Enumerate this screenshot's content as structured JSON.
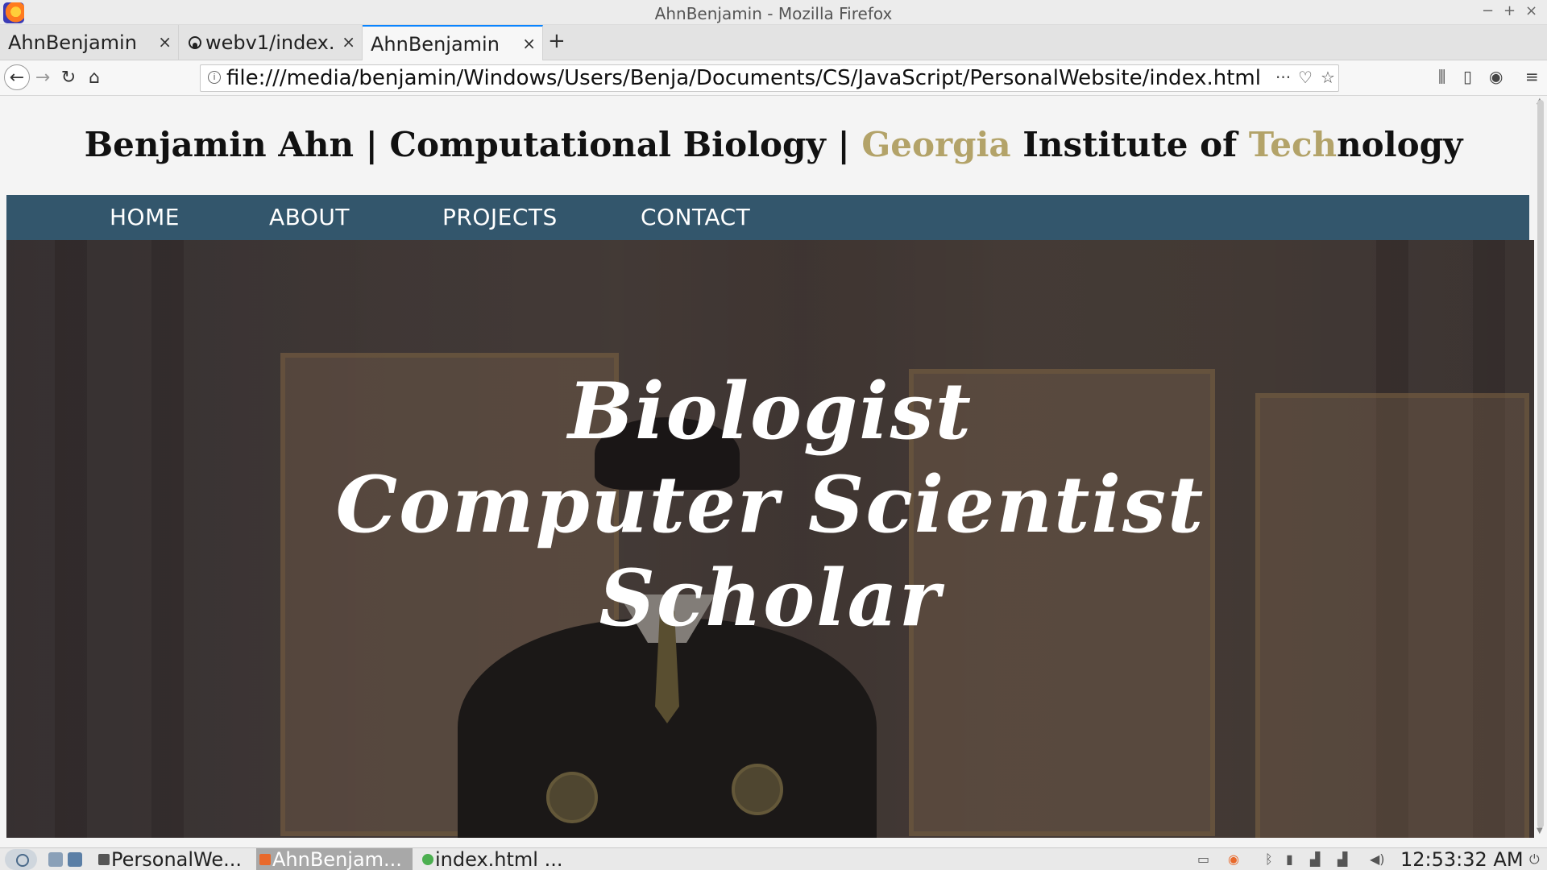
{
  "window": {
    "title": "AhnBenjamin - Mozilla Firefox",
    "controls": {
      "minimize": "−",
      "maximize": "+",
      "close": "×"
    }
  },
  "tabs": [
    {
      "label": "AhnBenjamin",
      "active": false,
      "icon": "none"
    },
    {
      "label": "webv1/index.",
      "active": false,
      "icon": "github-icon"
    },
    {
      "label": "AhnBenjamin",
      "active": true,
      "icon": "none"
    }
  ],
  "tab_close_glyph": "×",
  "new_tab_glyph": "+",
  "toolbar": {
    "back_glyph": "←",
    "forward_glyph": "→",
    "reload_glyph": "↻",
    "home_glyph": "⌂",
    "url": "file:///media/benjamin/Windows/Users/Benja/Documents/CS/JavaScript/PersonalWebsite/index.html",
    "page_actions_glyph": "···",
    "pocket_glyph": "♡",
    "bookmark_glyph": "☆",
    "library_glyph": "⫼",
    "sidebar_glyph": "▯",
    "account_glyph": "◉",
    "menu_glyph": "≡"
  },
  "site": {
    "title_parts": {
      "name": "Benjamin Ahn",
      "sep1": " | ",
      "field": "Computational Biology",
      "sep2": " | ",
      "georgia": "Georgia",
      "institute": " Institute of ",
      "tech": "Tech",
      "nology": "nology"
    },
    "accent_color": "#b3a369",
    "nav_color": "#33566c",
    "nav": [
      "HOME",
      "ABOUT",
      "PROJECTS",
      "CONTACT"
    ],
    "hero_lines": [
      "Biologist",
      "Computer Scientist",
      "Scholar"
    ]
  },
  "taskbar": {
    "tasks": [
      {
        "label": "PersonalWe...",
        "active": false
      },
      {
        "label": "AhnBenjam...",
        "active": true
      },
      {
        "label": "index.html ...",
        "active": false
      }
    ],
    "clock": "12:53:32 AM"
  }
}
